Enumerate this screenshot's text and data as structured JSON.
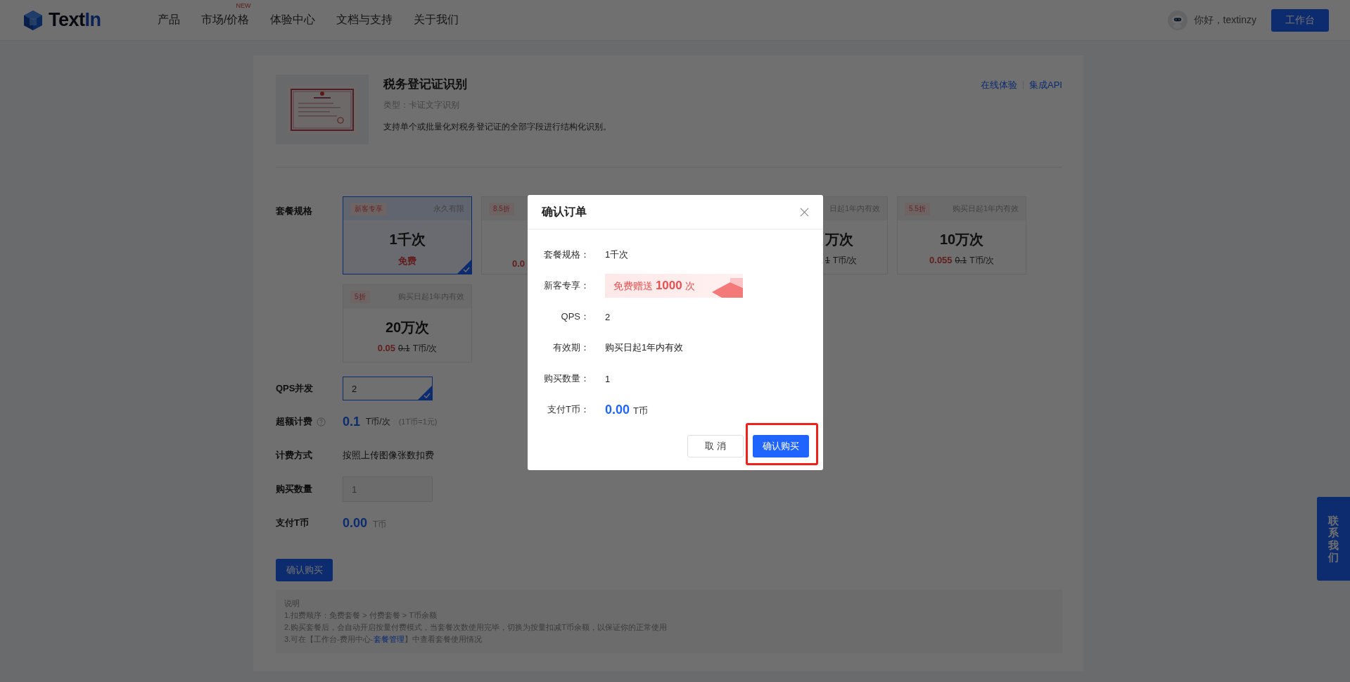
{
  "header": {
    "brand": [
      "Text",
      "In"
    ],
    "nav": [
      {
        "label": "产品"
      },
      {
        "label": "市场/价格",
        "badge": "NEW"
      },
      {
        "label": "体验中心"
      },
      {
        "label": "文档与支持"
      },
      {
        "label": "关于我们"
      }
    ],
    "greeting": "你好，textinzy",
    "workspace_button": "工作台"
  },
  "product": {
    "title": "税务登记证识别",
    "type": "类型：卡证文字识别",
    "description": "支持单个或批量化对税务登记证的全部字段进行结构化识别。",
    "links": [
      "在线体验",
      "集成API"
    ]
  },
  "form": {
    "package_label": "套餐规格",
    "packages": [
      {
        "kind": "full",
        "selected": true,
        "tag": "新客专享",
        "validity": "永久有限",
        "name": "1千次",
        "price": "免费"
      },
      {
        "kind": "cut-right",
        "selected": false,
        "tag": "8.5折",
        "price": "0.0"
      },
      {
        "kind": "cut-left",
        "selected": false,
        "validity": "日起1年内有效",
        "name": "万次",
        "old_price": "1",
        "unit": "T币/次"
      },
      {
        "kind": "full",
        "selected": false,
        "tag": "5.5折",
        "validity": "购买日起1年内有效",
        "name": "10万次",
        "price": "0.055",
        "old_price": "0.1",
        "unit": "T币/次"
      },
      {
        "kind": "full",
        "selected": false,
        "tag": "5折",
        "validity": "购买日起1年内有效",
        "name": "20万次",
        "price": "0.05",
        "old_price": "0.1",
        "unit": "T币/次"
      }
    ],
    "qps_label": "QPS并发",
    "qps_value": "2",
    "overage_label": "超额计费",
    "overage_price": "0.1",
    "overage_unit": "T币/次",
    "overage_note": "(1T币=1元)",
    "billing_label": "计费方式",
    "billing_value": "按照上传图像张数扣费",
    "quantity_label": "购买数量",
    "quantity_value": "1",
    "pay_label": "支付T币",
    "pay_value": "0.00",
    "pay_unit": "T币",
    "submit": "确认购买"
  },
  "notes": {
    "title": "说明",
    "lines": [
      {
        "text": "1.扣费顺序：免费套餐 > 付费套餐 > T币余额"
      },
      {
        "text": "2.购买套餐后，会自动开启按量付费模式，当套餐次数使用完毕，切换为按量扣减T币余额，以保证你的正常使用"
      },
      {
        "text": "3.可在【工作台-费用中心-",
        "link": "套餐管理",
        "after": "】中查看套餐使用情况"
      }
    ]
  },
  "contact_tab": "联系我们",
  "dialog": {
    "title": "确认订单",
    "rows": [
      {
        "kind": "text",
        "label": "套餐规格：",
        "value": "1千次"
      },
      {
        "kind": "promo",
        "label": "新客专享：",
        "value": "免费赠送 **1000** 次"
      },
      {
        "kind": "text",
        "label": "QPS：",
        "value": "2"
      },
      {
        "kind": "text",
        "label": "有效期：",
        "value": "购买日起1年内有效"
      },
      {
        "kind": "text",
        "label": "购买数量：",
        "value": "1"
      },
      {
        "kind": "price",
        "label": "支付T币：",
        "value": "0.00",
        "unit": "T币"
      }
    ],
    "cancel": "取 消",
    "confirm": "确认购买",
    "confirm_highlighted": true
  }
}
